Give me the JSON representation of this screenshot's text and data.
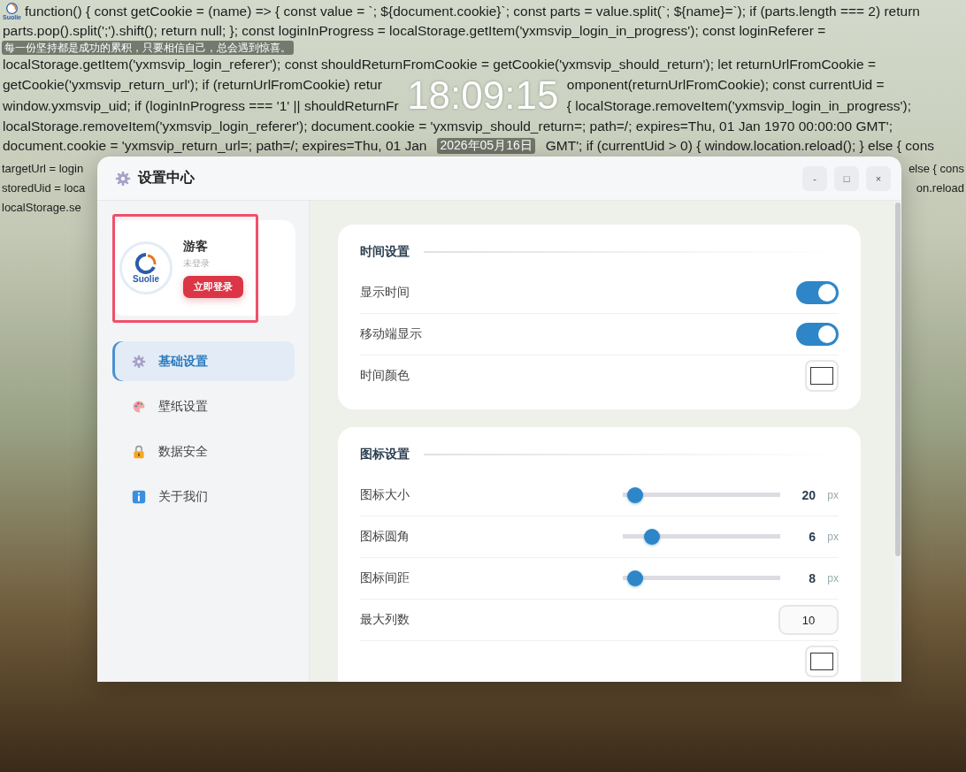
{
  "desktop": {
    "logo_text": "Suolie",
    "code_lines": [
      [
        "function() { const getCookie = (name) => { const value = `; ${document.cookie}`; const parts = value.split(`; ${name}=`); if (parts.length === 2) return"
      ],
      [
        "parts.pop().split(';').shift(); return null; }; const loginInProgress = localStorage.getItem('yxmsvip_login_in_progress'); const loginReferer ="
      ],
      [
        "localStorage.getItem('yxmsvip_login_referer'); const shouldReturnFromCookie = getCookie('yxmsvip_should_return'); let returnUrlFromCookie ="
      ],
      [
        "getCookie('yxmsvip_return_url'); if (returnUrlFromCookie) retur",
        "omponent(returnUrlFromCookie); const currentUid ="
      ],
      [
        "window.yxmsvip_uid; if (loginInProgress === '1' || shouldReturnFr",
        "{ localStorage.removeItem('yxmsvip_login_in_progress');"
      ],
      [
        "localStorage.removeItem('yxmsvip_login_referer'); document.cookie = 'yxmsvip_should_return=; path=/; expires=Thu, 01 Jan 1970 00:00:00 GMT';"
      ],
      [
        "document.cookie = 'yxmsvip_return_url=; path=/; expires=Thu, 01 Jan",
        "GMT'; if (currentUid > 0) { window.location.reload(); } else { cons"
      ]
    ],
    "cut_lines": [
      {
        "left": "targetUrl = login",
        "right": "else { cons"
      },
      {
        "left": "storedUid = loca",
        "right": "on.reload"
      },
      {
        "left": "localStorage.se"
      }
    ],
    "quote": "每一份坚持都是成功的累积，只要相信自己，总会遇到惊喜。",
    "clock": "18:09:15",
    "date": "2026年05月16日"
  },
  "window": {
    "title": "设置中心",
    "buttons": [
      "-",
      "□",
      "×"
    ]
  },
  "profile": {
    "name": "游客",
    "status": "未登录",
    "login_button": "立即登录",
    "avatar_text": "Suolie"
  },
  "sidebar": {
    "items": [
      {
        "label": "基础设置",
        "selected": true
      },
      {
        "label": "壁纸设置",
        "selected": false
      },
      {
        "label": "数据安全",
        "selected": false
      },
      {
        "label": "关于我们",
        "selected": false
      }
    ]
  },
  "sections": [
    {
      "title": "时间设置",
      "rows": [
        {
          "kind": "toggle",
          "label": "显示时间",
          "on": true
        },
        {
          "kind": "toggle",
          "label": "移动端显示",
          "on": true
        },
        {
          "kind": "color",
          "label": "时间颜色",
          "color": "#ffffff"
        }
      ]
    },
    {
      "title": "图标设置",
      "rows": [
        {
          "kind": "slider",
          "label": "图标大小",
          "level": 0.03,
          "value": "20",
          "unit": "px"
        },
        {
          "kind": "slider",
          "label": "图标圆角",
          "level": 0.15,
          "value": "6",
          "unit": "px"
        },
        {
          "kind": "slider",
          "label": "图标间距",
          "level": 0.03,
          "value": "8",
          "unit": "px"
        },
        {
          "kind": "number",
          "label": "最大列数",
          "value": "10"
        },
        {
          "kind": "color",
          "color": "#ffffff"
        }
      ]
    }
  ]
}
